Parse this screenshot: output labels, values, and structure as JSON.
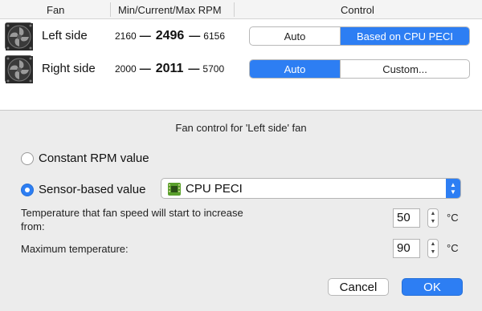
{
  "table": {
    "headers": {
      "fan": "Fan",
      "rpm": "Min/Current/Max RPM",
      "control": "Control"
    },
    "rows": [
      {
        "name": "Left side",
        "min": "2160",
        "current": "2496",
        "max": "6156",
        "options": [
          "Auto",
          "Based on CPU PECI"
        ],
        "selected": "Based on CPU PECI"
      },
      {
        "name": "Right side",
        "min": "2000",
        "current": "2011",
        "max": "5700",
        "options": [
          "Auto",
          "Custom..."
        ],
        "selected": "Auto"
      }
    ]
  },
  "panel": {
    "title": "Fan control for 'Left side' fan",
    "constant_label": "Constant RPM value",
    "sensor_label": "Sensor-based value",
    "selected_mode": "sensor",
    "sensor_select": {
      "value": "CPU PECI",
      "icon": "chip-icon"
    },
    "start_temp": {
      "label_line1": "Temperature that fan speed will start to increase",
      "label_line2": "from:",
      "value": "50",
      "unit": "°C"
    },
    "max_temp": {
      "label": "Maximum temperature:",
      "value": "90",
      "unit": "°C"
    }
  },
  "buttons": {
    "cancel": "Cancel",
    "ok": "OK"
  },
  "colors": {
    "accent": "#2d7ef3",
    "panel_bg": "#ececec"
  }
}
